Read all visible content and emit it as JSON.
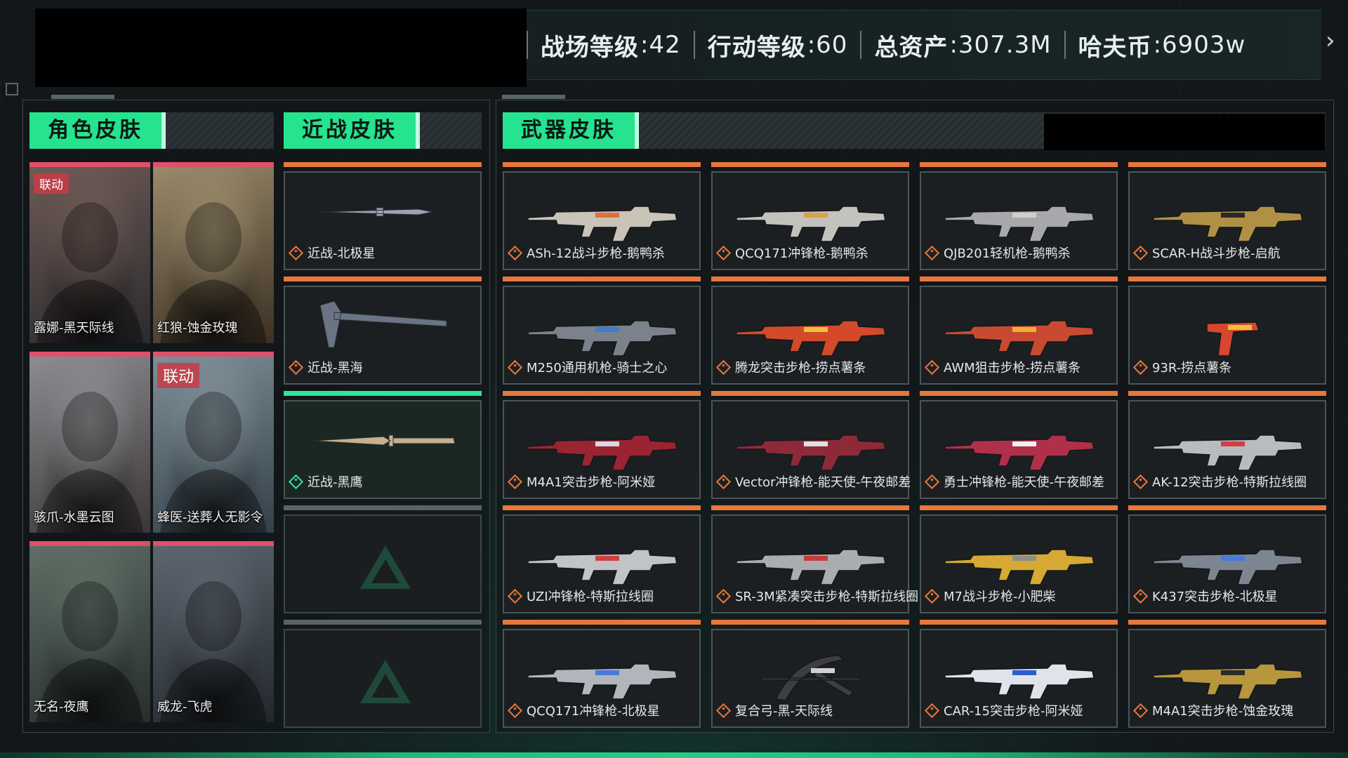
{
  "header": {
    "stats": [
      {
        "label": "战场等级",
        "value": ":42"
      },
      {
        "label": "行动等级",
        "value": ":60"
      },
      {
        "label": "总资产",
        "value": ":307.3M"
      },
      {
        "label": "哈夫币",
        "value": ":6903w"
      }
    ],
    "next_icon": "chevron-right-icon"
  },
  "sections": {
    "character": "角色皮肤",
    "melee": "近战皮肤",
    "weapon": "武器皮肤"
  },
  "character_skins": [
    {
      "name": "露娜-黑天际线",
      "badge": "联动",
      "palette": [
        "#6d5a55",
        "#2b2a2e"
      ]
    },
    {
      "name": "红狼-蚀金玫瑰",
      "badge": "",
      "palette": [
        "#9a8a6a",
        "#3b3023"
      ]
    },
    {
      "name": "骇爪-水墨云图",
      "badge": "",
      "palette": [
        "#8d8c90",
        "#3a3637"
      ]
    },
    {
      "name": "蜂医-送葬人无影令",
      "badge": "联动",
      "palette": [
        "#7f8e97",
        "#33404a"
      ]
    },
    {
      "name": "无名-夜鹰",
      "badge": "",
      "palette": [
        "#5f6e66",
        "#262e2b"
      ]
    },
    {
      "name": "威龙-飞虎",
      "badge": "",
      "palette": [
        "#5d6670",
        "#22272c"
      ]
    }
  ],
  "melee_skins": [
    {
      "name": "近战-北极星",
      "state": "normal"
    },
    {
      "name": "近战-黑海",
      "state": "normal"
    },
    {
      "name": "近战-黑鹰",
      "state": "active"
    },
    {
      "name": "",
      "state": "empty"
    },
    {
      "name": "",
      "state": "empty"
    }
  ],
  "weapon_skins": [
    {
      "name": "ASh-12战斗步枪-鹅鸭杀",
      "color": "#c9c3b8",
      "accent": "#e0703a"
    },
    {
      "name": "QCQ171冲锋枪-鹅鸭杀",
      "color": "#c4c2bc",
      "accent": "#d8a24a"
    },
    {
      "name": "QJB201轻机枪-鹅鸭杀",
      "color": "#a8a8aa",
      "accent": "#cfcfcf"
    },
    {
      "name": "SCAR-H战斗步枪-启航",
      "color": "#b09044",
      "accent": "#2a2a2a"
    },
    {
      "name": "M250通用机枪-骑士之心",
      "color": "#7b828c",
      "accent": "#3a7fd0"
    },
    {
      "name": "腾龙突击步枪-捞点薯条",
      "color": "#d24a2a",
      "accent": "#f0c040"
    },
    {
      "name": "AWM狙击步枪-捞点薯条",
      "color": "#c84a32",
      "accent": "#f0b030"
    },
    {
      "name": "93R-捞点薯条",
      "color": "#d5472e",
      "accent": "#f2c23a"
    },
    {
      "name": "M4A1突击步枪-阿米娅",
      "color": "#9b2433",
      "accent": "#d8d8e0"
    },
    {
      "name": "Vector冲锋枪-能天使-午夜邮差",
      "color": "#8e2a38",
      "accent": "#e0e0e0"
    },
    {
      "name": "勇士冲锋枪-能天使-午夜邮差",
      "color": "#b0304a",
      "accent": "#f0f0f0"
    },
    {
      "name": "AK-12突击步枪-特斯拉线圈",
      "color": "#b8bcc0",
      "accent": "#d04040"
    },
    {
      "name": "UZI冲锋枪-特斯拉线圈",
      "color": "#c0c4c6",
      "accent": "#d04040"
    },
    {
      "name": "SR-3M紧凑突击步枪-特斯拉线圈",
      "color": "#a9adb0",
      "accent": "#c83a3a"
    },
    {
      "name": "M7战斗步枪-小肥柴",
      "color": "#d6a834",
      "accent": "#8c8c8c"
    },
    {
      "name": "K437突击步枪-北极星",
      "color": "#7d8590",
      "accent": "#4a7ad8"
    },
    {
      "name": "QCQ171冲锋枪-北极星",
      "color": "#b2b6bc",
      "accent": "#4a7ad8"
    },
    {
      "name": "复合弓-黑-天际线",
      "color": "#3e3e40",
      "accent": "#d0d0d0"
    },
    {
      "name": "CAR-15突击步枪-阿米娅",
      "color": "#dfe4ea",
      "accent": "#2a5fd0"
    },
    {
      "name": "M4A1突击步枪-蚀金玫瑰",
      "color": "#b8963c",
      "accent": "#2a2a2a"
    }
  ]
}
